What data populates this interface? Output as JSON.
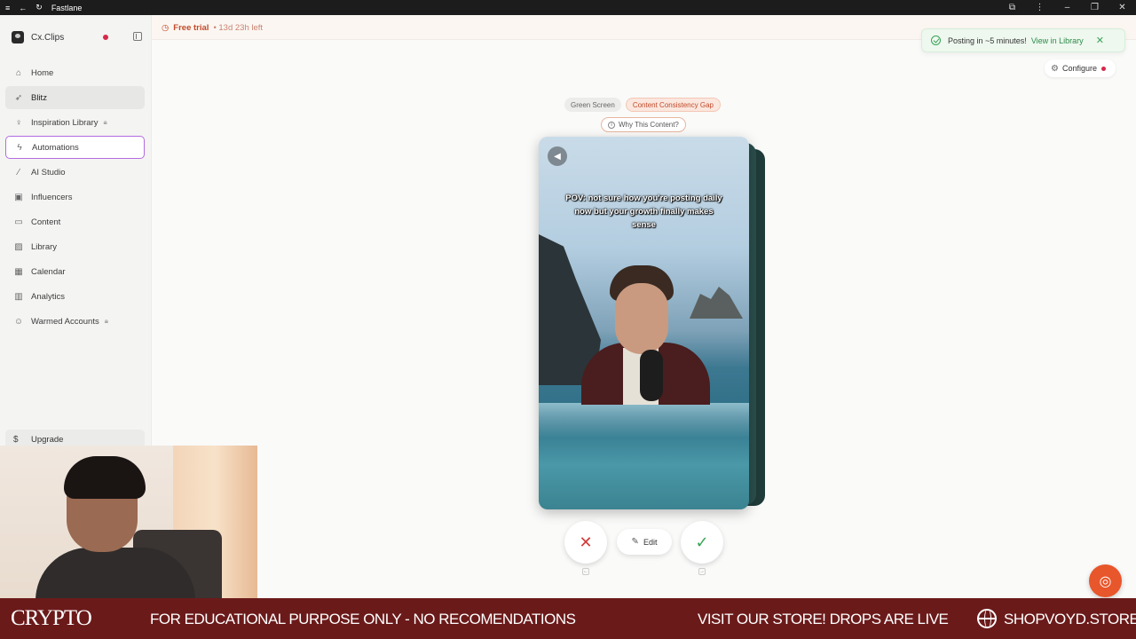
{
  "titlebar": {
    "app_title": "Fastlane",
    "icons": [
      "menu-icon",
      "back-icon",
      "reload-icon",
      "extensions-icon",
      "more-icon",
      "minimize-icon",
      "restore-icon",
      "close-icon"
    ]
  },
  "sidebar": {
    "workspace": "Cx.Clips",
    "items": [
      {
        "label": "Home",
        "icon": "home-icon"
      },
      {
        "label": "Blitz",
        "icon": "rocket-icon"
      },
      {
        "label": "Inspiration Library",
        "icon": "lightbulb-icon",
        "locked": true
      },
      {
        "label": "Automations",
        "icon": "bolt-icon"
      },
      {
        "label": "AI Studio",
        "icon": "wand-icon"
      },
      {
        "label": "Influencers",
        "icon": "id-card-icon"
      },
      {
        "label": "Content",
        "icon": "content-icon"
      },
      {
        "label": "Library",
        "icon": "image-icon"
      },
      {
        "label": "Calendar",
        "icon": "calendar-icon"
      },
      {
        "label": "Analytics",
        "icon": "bar-chart-icon"
      },
      {
        "label": "Warmed Accounts",
        "icon": "users-icon",
        "locked": true
      }
    ],
    "upgrade_label": "Upgrade"
  },
  "topbar": {
    "trial_label": "Free trial",
    "trial_remaining": "• 13d 23h left"
  },
  "toast": {
    "message": "Posting in ~5 minutes!",
    "link": "View in Library"
  },
  "configure_label": "Configure",
  "tags": [
    "Green Screen",
    "Content Consistency Gap"
  ],
  "why_label": "Why This Content?",
  "video": {
    "caption": "POV: not sure how you're posting daily now but your growth finally makes sense"
  },
  "actions": {
    "edit_label": "Edit"
  },
  "ticker": {
    "brand": "CRYPTO",
    "disclaimer": "FOR EDUCATIONAL PURPOSE ONLY - NO RECOMENDATIONS",
    "promo": "VISIT OUR STORE! DROPS ARE LIVE",
    "store": "SHOPVOYD.STORE"
  },
  "colors": {
    "accent": "#e8562b",
    "danger": "#d6284a",
    "success": "#3aa356",
    "ticker_bg": "#6b1a1a"
  }
}
